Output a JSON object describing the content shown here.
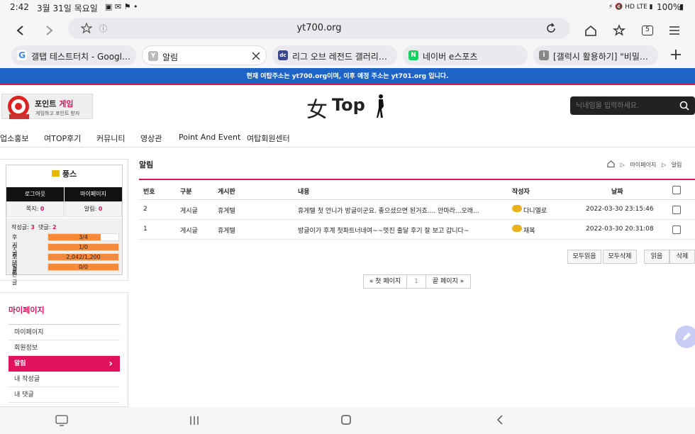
{
  "status": {
    "time": "2:42",
    "date": "3월 31일 목요일",
    "icons_left": "▣ ✉ ⚑ •",
    "battery": "100%",
    "network": "HD LTE"
  },
  "browser": {
    "url": "yt700.org",
    "tabs": [
      {
        "label": "갤탭 테스트터치 - Google 검...",
        "fav": "G",
        "color": "#4285f4"
      },
      {
        "label": "알림",
        "fav": "Y",
        "color": "#bbbbbb"
      },
      {
        "label": "리그 오브 레전드 갤러리입니...",
        "fav": "dc",
        "color": "#3b4890"
      },
      {
        "label": "네이버 e스포츠",
        "fav": "N",
        "color": "#19ce60"
      },
      {
        "label": "[갤럭시 활용하기] \"비밀번호 ...",
        "fav": "i",
        "color": "#888888"
      }
    ],
    "tab_count": "5"
  },
  "notice": "현재 여탑주소는 yt700.org이며, 이후 예정 주소는 yt701.org 입니다.",
  "header": {
    "promo_title_1": "포인트",
    "promo_title_2": "게임",
    "promo_sub": "게임하고 포인트 받자",
    "logo_han": "女",
    "logo_text": "Top",
    "search_placeholder": "닉네임을 입력하세요."
  },
  "nav": [
    "업소홍보",
    "여TOP후기",
    "커뮤니티",
    "영상관",
    "Point And Event",
    "여탑회원센터"
  ],
  "profile": {
    "name": "풍스",
    "logout": "로그아웃",
    "mypage": "마이페이지",
    "note_label": "쪽지:",
    "note_value": "0",
    "alert_label": "알림:",
    "alert_value": "0",
    "posts_label": "작성글:",
    "posts_value": "3",
    "comments_label": "댓글:",
    "comments_value": "2",
    "bars": [
      {
        "label": "후기글",
        "value": "3/4",
        "fill": 0.75
      },
      {
        "label": "후기댓글",
        "value": "1/0",
        "fill": 1.0
      },
      {
        "label": "포인트",
        "value": "2,042/1,200",
        "fill": 1.0
      },
      {
        "label": "일반글",
        "value": "0/0",
        "fill": 1.0
      }
    ]
  },
  "mymenu": {
    "title": "마이페이지",
    "items": [
      "마이페이지",
      "회원정보",
      "알림",
      "내 작성글",
      "내 댓글"
    ],
    "active_index": 2
  },
  "main": {
    "title": "알림",
    "breadcrumb": [
      "마이페이지",
      "알림"
    ],
    "columns": [
      "번호",
      "구분",
      "게시판",
      "내용",
      "작성자",
      "날짜"
    ],
    "rows": [
      {
        "num": "2",
        "type": "게시글",
        "board": "휴게텔",
        "content": "휴게텔 첫 언니가 방글이군요. 좋으셨으면 된거죠.... 안마라...오래...",
        "author": "다니엘로",
        "date": "2022-03-30 23:15:46"
      },
      {
        "num": "1",
        "type": "게시글",
        "board": "휴게텔",
        "content": "방글이가 후계 첫파트너네여~~멋진 출달 후기 잘 보고 갑니다~",
        "author": "재복",
        "date": "2022-03-30 20:31:08"
      }
    ],
    "buttons": [
      "모두읽음",
      "모두삭제",
      "읽음",
      "삭제"
    ],
    "pager": {
      "first": "« 첫 페이지",
      "current": "1",
      "last": "끝 페이지 »"
    }
  },
  "colors": {
    "accent": "#e0125e",
    "notice": "#1e63c6",
    "bar": "#f58a3c"
  }
}
